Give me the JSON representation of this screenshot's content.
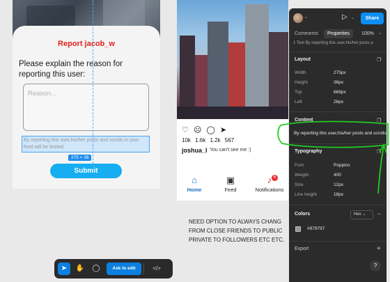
{
  "left_mock": {
    "modal_title": "Report jacob_w",
    "prompt": "Please explain the reason for reporting this user:",
    "reason_placeholder": "Reason...",
    "disclaimer": "By reporting this user,his/her posts and scrolls in your feed will be limited",
    "size_badge": "275 × 36",
    "submit_label": "Submit"
  },
  "right_mock": {
    "counts": "10k 1.6k 1.2k 567",
    "username": "joshua_l",
    "caption": "You can't see me :)",
    "nav": [
      {
        "label": "Home",
        "icon": "home-icon"
      },
      {
        "label": "Feed",
        "icon": "feed-icon"
      },
      {
        "label": "Notifications",
        "icon": "bell-icon"
      }
    ],
    "notification_badge": "6"
  },
  "comment_note": {
    "lines": [
      "NEED OPTION TO ALWAYS CHANG",
      "FROM CLOSE FRIENDS TO PUBLIC",
      "PRIVATE TO FOLLOWERS ETC ETC."
    ]
  },
  "toolbar": {
    "ask_to_edit": "Ask to edit",
    "code_icon": "</>"
  },
  "panel": {
    "share_label": "Share",
    "tabs": [
      "Comments",
      "Properties"
    ],
    "zoom": "100%",
    "layer_row": "1  Text  By reporting this user,his/her posts a",
    "layout": {
      "heading": "Layout",
      "rows": [
        {
          "label": "Width",
          "value": "275px"
        },
        {
          "label": "Height",
          "value": "36px"
        },
        {
          "label": "Top",
          "value": "669px"
        },
        {
          "label": "Left",
          "value": "26px"
        }
      ]
    },
    "content": {
      "heading": "Content",
      "value": "By reporting this user,his/her posts and scrolls"
    },
    "typography": {
      "heading": "Typography",
      "rows": [
        {
          "label": "Font",
          "value": "Poppins"
        },
        {
          "label": "Weight",
          "value": "400"
        },
        {
          "label": "Size",
          "value": "12px"
        },
        {
          "label": "Line height",
          "value": "18px"
        }
      ]
    },
    "colors": {
      "heading": "Colors",
      "format": "Hex",
      "swatch": "#979797"
    },
    "export_heading": "Export",
    "help_label": "?"
  },
  "colors": {
    "accent_blue": "#0d8ef2",
    "report_red": "#e0201b",
    "submit_blue": "#16aef0",
    "panel_bg": "#2b2b2b",
    "annotation_green": "#22cc22"
  }
}
